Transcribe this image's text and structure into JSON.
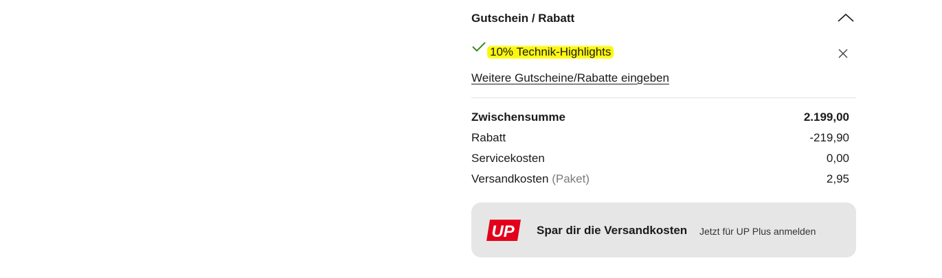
{
  "coupon": {
    "title": "Gutschein / Rabatt",
    "applied_code": "10% Technik-Highlights",
    "more_link": "Weitere Gutscheine/Rabatte eingeben",
    "collapse_icon": "chevron-up-icon",
    "remove_icon": "close-icon",
    "check_icon": "checkmark-icon",
    "check_color": "#3a8a1f",
    "highlight_color": "#fbf70c"
  },
  "summary": {
    "rows": [
      {
        "label": "Zwischensumme",
        "value": "2.199,00"
      },
      {
        "label": "Rabatt",
        "value": "-219,90"
      },
      {
        "label": "Servicekosten",
        "value": "0,00"
      },
      {
        "label": "Versandkosten",
        "note": "(Paket)",
        "value": "2,95"
      }
    ]
  },
  "promo": {
    "logo_text": "UP",
    "logo_color": "#e3001b",
    "title": "Spar dir die Versandkosten",
    "subtitle": "Jetzt für UP Plus anmelden"
  }
}
